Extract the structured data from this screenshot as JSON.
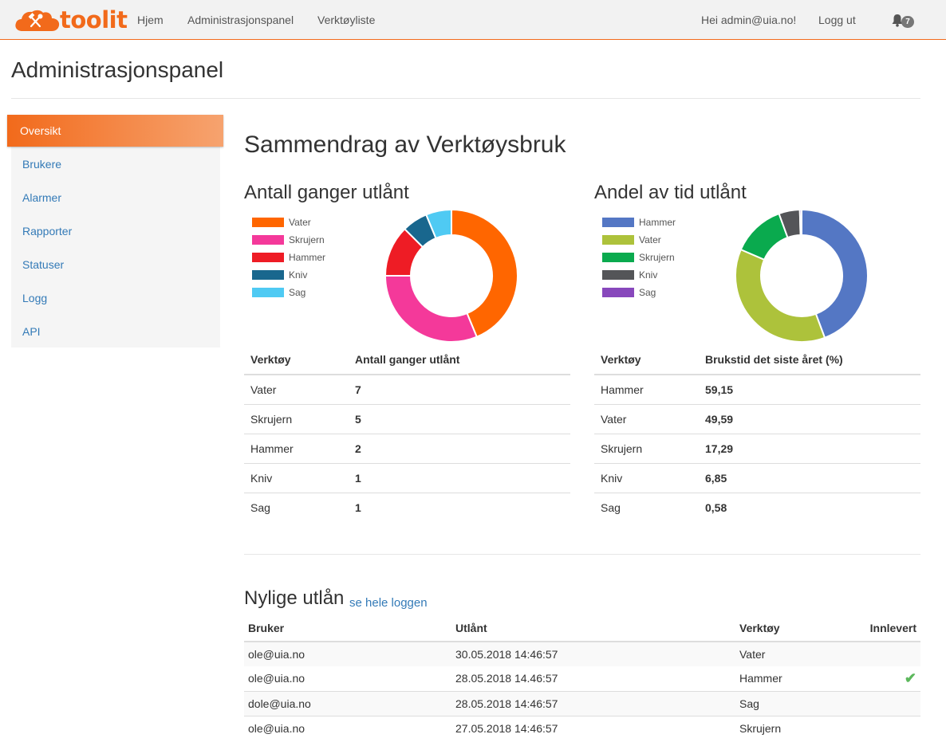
{
  "brand": {
    "name": "toolit",
    "logo_icon": "tools-cloud-icon"
  },
  "nav": {
    "links": [
      "Hjem",
      "Administrasjonspanel",
      "Verktøyliste"
    ],
    "greeting": "Hei admin@uia.no!",
    "logout": "Logg ut",
    "notification_count": "7"
  },
  "page": {
    "title": "Administrasjonspanel"
  },
  "sidebar": {
    "items": [
      {
        "label": "Oversikt",
        "active": true
      },
      {
        "label": "Brukere",
        "active": false
      },
      {
        "label": "Alarmer",
        "active": false
      },
      {
        "label": "Rapporter",
        "active": false
      },
      {
        "label": "Statuser",
        "active": false
      },
      {
        "label": "Logg",
        "active": false
      },
      {
        "label": "API",
        "active": false
      }
    ]
  },
  "summary": {
    "title": "Sammendrag av Verktøysbruk"
  },
  "colors": {
    "accent": "#f26a1b",
    "link": "#337ab7",
    "check": "#5cb85c"
  },
  "chart_data": [
    {
      "type": "pie",
      "title": "Antall ganger utlånt",
      "legend_position": "top-left",
      "categories": [
        "Vater",
        "Skrujern",
        "Hammer",
        "Kniv",
        "Sag"
      ],
      "values": [
        7,
        5,
        2,
        1,
        1
      ],
      "colors": [
        "#ff6600",
        "#f4399a",
        "#ee1c25",
        "#19678e",
        "#4fcaf3"
      ],
      "table": {
        "headers": [
          "Verktøy",
          "Antall ganger utlånt"
        ],
        "rows": [
          [
            "Vater",
            "7"
          ],
          [
            "Skrujern",
            "5"
          ],
          [
            "Hammer",
            "2"
          ],
          [
            "Kniv",
            "1"
          ],
          [
            "Sag",
            "1"
          ]
        ]
      }
    },
    {
      "type": "pie",
      "title": "Andel av tid utlånt",
      "legend_position": "top-left",
      "categories": [
        "Hammer",
        "Vater",
        "Skrujern",
        "Kniv",
        "Sag"
      ],
      "values": [
        59.15,
        49.59,
        17.29,
        6.85,
        0.58
      ],
      "colors": [
        "#5477c4",
        "#adc23b",
        "#0aaa4e",
        "#545558",
        "#8848bc"
      ],
      "table": {
        "headers": [
          "Verktøy",
          "Brukstid det siste året (%)"
        ],
        "rows": [
          [
            "Hammer",
            "59,15"
          ],
          [
            "Vater",
            "49,59"
          ],
          [
            "Skrujern",
            "17,29"
          ],
          [
            "Kniv",
            "6,85"
          ],
          [
            "Sag",
            "0,58"
          ]
        ]
      }
    }
  ],
  "recent": {
    "title": "Nylige utlån",
    "link": "se hele loggen",
    "headers": [
      "Bruker",
      "Utlånt",
      "Verktøy",
      "Innlevert"
    ],
    "rows": [
      {
        "user": "ole@uia.no",
        "date": "30.05.2018 14:46:57",
        "tool": "Vater",
        "returned": false
      },
      {
        "user": "ole@uia.no",
        "date": "28.05.2018 14.46:57",
        "tool": "Hammer",
        "returned": true
      },
      {
        "user": "dole@uia.no",
        "date": "28.05.2018 14:46:57",
        "tool": "Sag",
        "returned": false
      },
      {
        "user": "ole@uia.no",
        "date": "27.05.2018 14:46:57",
        "tool": "Skrujern",
        "returned": false
      }
    ]
  }
}
